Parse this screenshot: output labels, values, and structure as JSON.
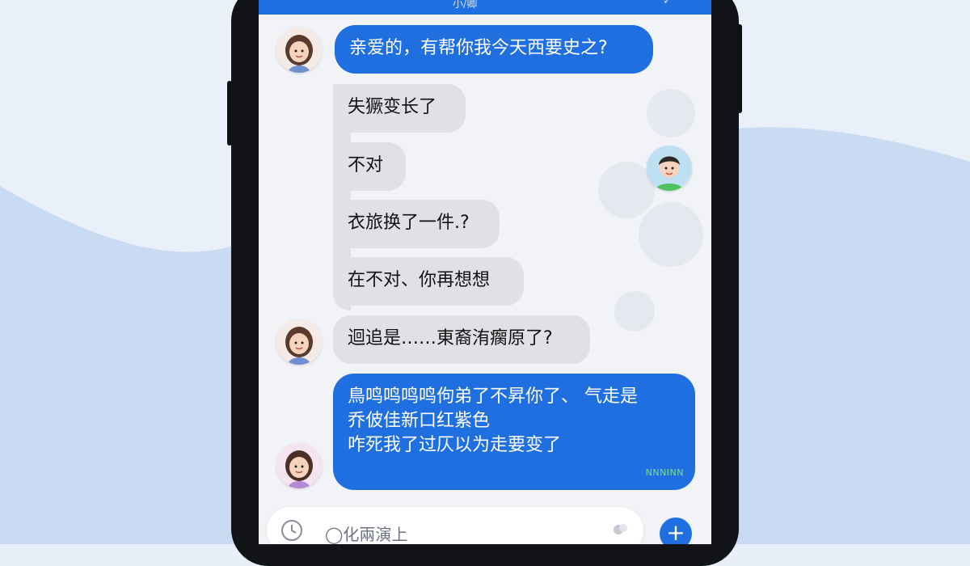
{
  "header": {
    "title": "小/卿",
    "back_icon": "back-arrow-icon"
  },
  "messages": [
    {
      "text": "亲爱的，有帮你我今天西要史之?",
      "style": "blue",
      "sender": "her"
    },
    {
      "text": "失獗变长了",
      "style": "gray"
    },
    {
      "text": "不对",
      "style": "gray"
    },
    {
      "text": "衣旅换了一件.?",
      "style": "gray"
    },
    {
      "text": "在不对、你再想想",
      "style": "gray"
    },
    {
      "text": "迴追是……東裔洧瘸原了?",
      "style": "gray",
      "sender": "her"
    },
    {
      "lines": [
        "鳥鸣鸣鸣鸣佝弟了不昇你了、 气走是",
        "乔佊佳新口红紫色",
        "咋死我了过仄以为走要变了"
      ],
      "stamp": "NNNINN",
      "style": "blue",
      "sender": "her"
    }
  ],
  "composer": {
    "placeholder": "◯化兩演上"
  },
  "colors": {
    "accent": "#1f6fe0",
    "bubble_gray": "#dfe1e6",
    "screen_bg": "#f1f3f6"
  },
  "icons": [
    "clock-icon",
    "emoji-icon",
    "plus-icon"
  ]
}
